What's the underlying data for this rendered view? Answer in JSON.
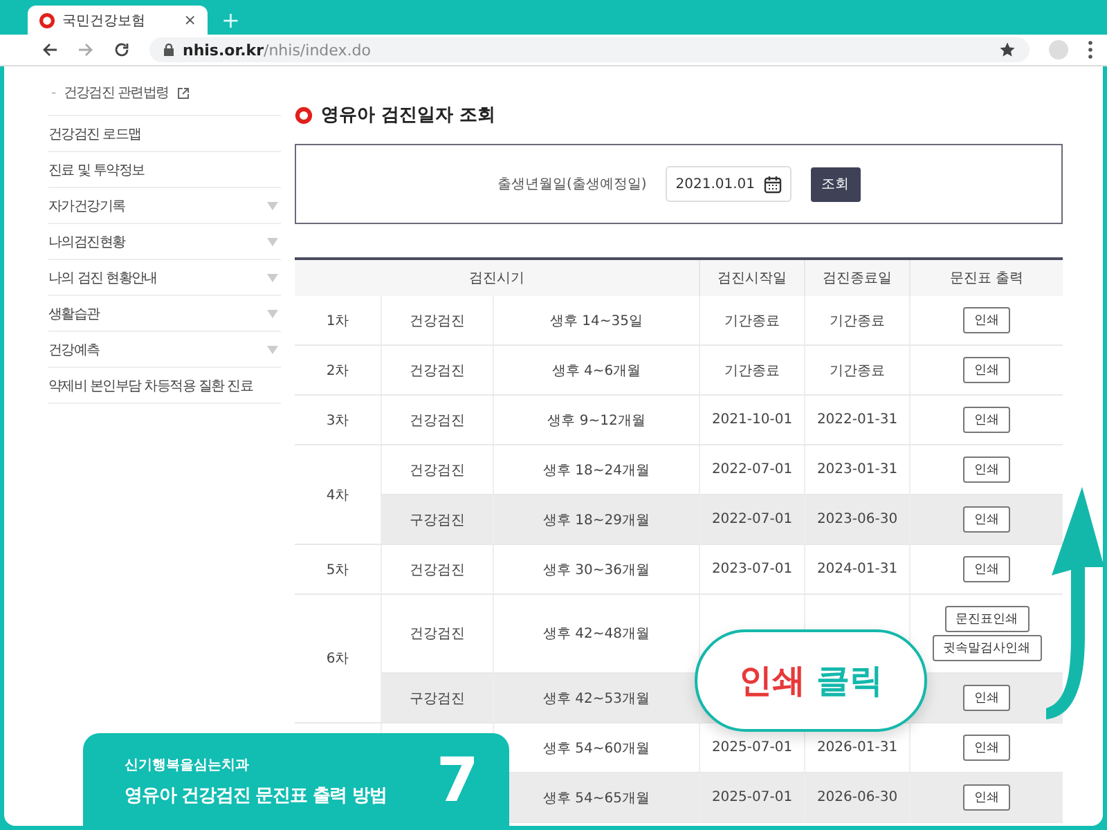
{
  "browser": {
    "tab_title": "국민건강보험",
    "tab_close": "×",
    "new_tab": "+",
    "address": {
      "host": "nhis.or.kr",
      "path": "/nhis/index.do"
    }
  },
  "sidebar": {
    "sub_link": {
      "bullet": "-",
      "label": "건강검진 관련법령"
    },
    "items": [
      {
        "label": "건강검진 로드맵",
        "expandable": false
      },
      {
        "label": "진료 및 투약정보",
        "expandable": false
      },
      {
        "label": "자가건강기록",
        "expandable": true
      },
      {
        "label": "나의검진현황",
        "expandable": true
      },
      {
        "label": "나의 검진 현황안내",
        "expandable": true
      },
      {
        "label": "생활습관",
        "expandable": true
      },
      {
        "label": "건강예측",
        "expandable": true
      },
      {
        "label": "약제비 본인부담 차등적용 질환 진료",
        "expandable": false
      }
    ]
  },
  "page_title": "영유아 검진일자 조회",
  "search": {
    "label": "출생년월일(출생예정일)",
    "value": "2021.01.01",
    "button": "조회"
  },
  "table": {
    "columns": [
      "검진시기",
      "검진시작일",
      "검진종료일",
      "문진표 출력"
    ],
    "groups": [
      {
        "round": "1차",
        "exams": [
          {
            "type": "건강검진",
            "period": "생후 14~35일",
            "start": "기간종료",
            "end": "기간종료",
            "shaded": false,
            "buttons": [
              "인쇄"
            ]
          }
        ]
      },
      {
        "round": "2차",
        "exams": [
          {
            "type": "건강검진",
            "period": "생후 4~6개월",
            "start": "기간종료",
            "end": "기간종료",
            "shaded": false,
            "buttons": [
              "인쇄"
            ]
          }
        ]
      },
      {
        "round": "3차",
        "exams": [
          {
            "type": "건강검진",
            "period": "생후 9~12개월",
            "start": "2021-10-01",
            "end": "2022-01-31",
            "shaded": false,
            "buttons": [
              "인쇄"
            ]
          }
        ]
      },
      {
        "round": "4차",
        "exams": [
          {
            "type": "건강검진",
            "period": "생후 18~24개월",
            "start": "2022-07-01",
            "end": "2023-01-31",
            "shaded": false,
            "buttons": [
              "인쇄"
            ]
          },
          {
            "type": "구강검진",
            "period": "생후 18~29개월",
            "start": "2022-07-01",
            "end": "2023-06-30",
            "shaded": true,
            "buttons": [
              "인쇄"
            ]
          }
        ]
      },
      {
        "round": "5차",
        "exams": [
          {
            "type": "건강검진",
            "period": "생후 30~36개월",
            "start": "2023-07-01",
            "end": "2024-01-31",
            "shaded": false,
            "buttons": [
              "인쇄"
            ]
          }
        ]
      },
      {
        "round": "6차",
        "exams": [
          {
            "type": "건강검진",
            "period": "생후 42~48개월",
            "shaded": false,
            "buttons": [
              "문진표인쇄",
              "귓속말검사인쇄"
            ]
          },
          {
            "type": "구강검진",
            "period": "생후 42~53개월",
            "shaded": true,
            "buttons": [
              "인쇄"
            ]
          }
        ]
      },
      {
        "exams": [
          {
            "period": "생후 54~60개월",
            "start": "2025-07-01",
            "end": "2026-01-31",
            "shaded": false,
            "buttons": [
              "인쇄"
            ]
          },
          {
            "period": "생후 54~65개월",
            "start": "2025-07-01",
            "end": "2026-06-30",
            "shaded": true,
            "buttons": [
              "인쇄"
            ]
          }
        ]
      }
    ]
  },
  "callout": [
    {
      "text": "인쇄",
      "color": "#e8393a"
    },
    {
      "text": "클릭",
      "color": "#14b8ab"
    }
  ],
  "banner": {
    "subtitle": "신기행복을심는치과",
    "title": "영유아 건강검진 문진표 출력 방법",
    "step": "7"
  }
}
